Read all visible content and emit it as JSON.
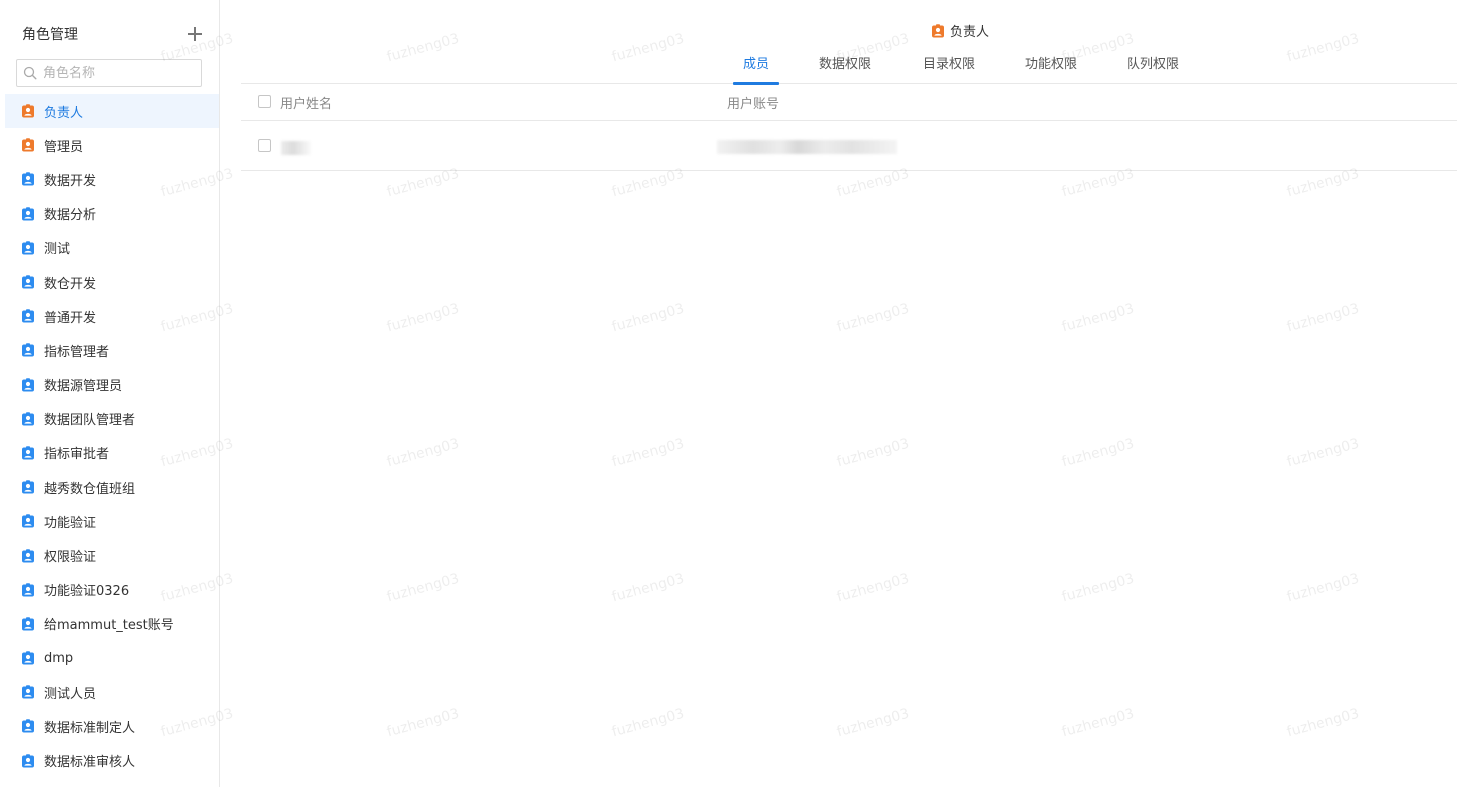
{
  "sidebar": {
    "title": "角色管理",
    "search": {
      "placeholder": "角色名称",
      "value": ""
    },
    "roles": [
      {
        "label": "负责人",
        "type": "owner",
        "active": true
      },
      {
        "label": "管理员",
        "type": "owner",
        "active": false
      },
      {
        "label": "数据开发",
        "type": "normal",
        "active": false
      },
      {
        "label": "数据分析",
        "type": "normal",
        "active": false
      },
      {
        "label": "测试",
        "type": "normal",
        "active": false
      },
      {
        "label": "数仓开发",
        "type": "normal",
        "active": false
      },
      {
        "label": "普通开发",
        "type": "normal",
        "active": false
      },
      {
        "label": "指标管理者",
        "type": "normal",
        "active": false
      },
      {
        "label": "数据源管理员",
        "type": "normal",
        "active": false
      },
      {
        "label": "数据团队管理者",
        "type": "normal",
        "active": false
      },
      {
        "label": "指标审批者",
        "type": "normal",
        "active": false
      },
      {
        "label": "越秀数仓值班组",
        "type": "normal",
        "active": false
      },
      {
        "label": "功能验证",
        "type": "normal",
        "active": false
      },
      {
        "label": "权限验证",
        "type": "normal",
        "active": false
      },
      {
        "label": "功能验证0326",
        "type": "normal",
        "active": false
      },
      {
        "label": "给mammut_test账号",
        "type": "normal",
        "active": false
      },
      {
        "label": "dmp",
        "type": "normal",
        "active": false
      },
      {
        "label": "测试人员",
        "type": "normal",
        "active": false
      },
      {
        "label": "数据标准制定人",
        "type": "normal",
        "active": false
      },
      {
        "label": "数据标准审核人",
        "type": "normal",
        "active": false
      }
    ]
  },
  "main": {
    "role_title": "负责人",
    "tabs": [
      {
        "label": "成员",
        "active": true
      },
      {
        "label": "数据权限",
        "active": false
      },
      {
        "label": "目录权限",
        "active": false
      },
      {
        "label": "功能权限",
        "active": false
      },
      {
        "label": "队列权限",
        "active": false
      }
    ],
    "table": {
      "columns": [
        "用户姓名",
        "用户账号"
      ],
      "rows": 1
    }
  },
  "watermark": "fuzheng03",
  "colors": {
    "accent": "#1f7be0",
    "owner_icon": "#ee7a2c",
    "role_icon": "#2d8cf0",
    "active_bg": "#eef5fe"
  },
  "icons": {
    "add": "plus-icon",
    "search": "search-icon",
    "owner_role": "badge-user-orange-icon",
    "role": "badge-user-blue-icon"
  }
}
